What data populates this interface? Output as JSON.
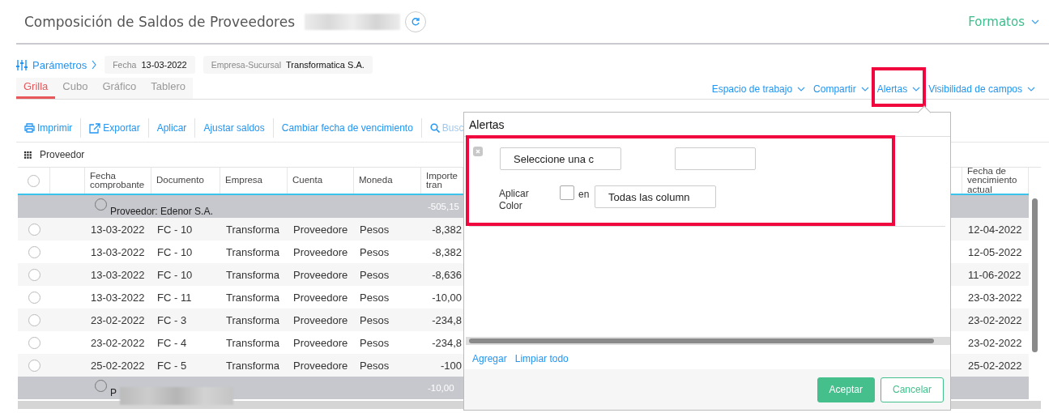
{
  "header": {
    "title": "Composición de Saldos de Proveedores",
    "formats_menu": "Formatos"
  },
  "parameters": {
    "label": "Parámetros",
    "fields": [
      {
        "label": "Fecha",
        "value": "13-03-2022"
      },
      {
        "label": "Empresa-Sucursal",
        "value": "Transformatica S.A."
      }
    ]
  },
  "tabs": [
    {
      "label": "Grilla",
      "selected": true
    },
    {
      "label": "Cubo",
      "selected": false
    },
    {
      "label": "Gráfico",
      "selected": false
    },
    {
      "label": "Tablero",
      "selected": false
    }
  ],
  "view_menus": [
    {
      "label": "Espacio de trabajo",
      "highlighted": false
    },
    {
      "label": "Compartir",
      "highlighted": false
    },
    {
      "label": "Alertas",
      "highlighted": true
    },
    {
      "label": "Visibilidad de campos",
      "highlighted": false
    }
  ],
  "toolbar": [
    {
      "kind": "print",
      "label": "Imprimir"
    },
    {
      "kind": "export",
      "label": "Exportar"
    },
    {
      "kind": "plain",
      "label": "Aplicar"
    },
    {
      "kind": "plain",
      "label": "Ajustar saldos"
    },
    {
      "kind": "plain",
      "label": "Cambiar fecha de vencimiento"
    },
    {
      "kind": "search",
      "label": "Busc"
    }
  ],
  "grouping": {
    "label": "Proveedor"
  },
  "table": {
    "all_selected": false,
    "columns": [
      "Fecha comprobante",
      "Documento",
      "Empresa",
      "Cuenta",
      "Moneda",
      "Importe tran",
      "Fecha de vencimiento actual"
    ],
    "rows": [
      {
        "kind": "group",
        "selected": false,
        "label": "Proveedor: Edenor S.A.",
        "amount": "-505,15"
      },
      {
        "kind": "data",
        "selected": false,
        "cells": [
          "13-03-2022",
          "FC - 10",
          "Transforma",
          "Proveedore",
          "Pesos",
          "-8,382",
          "12-04-2022"
        ]
      },
      {
        "kind": "data",
        "selected": false,
        "cells": [
          "13-03-2022",
          "FC - 10",
          "Transforma",
          "Proveedore",
          "Pesos",
          "-8,382",
          "12-05-2022"
        ]
      },
      {
        "kind": "data",
        "selected": false,
        "cells": [
          "13-03-2022",
          "FC - 10",
          "Transforma",
          "Proveedore",
          "Pesos",
          "-8,636",
          "11-06-2022"
        ]
      },
      {
        "kind": "data",
        "selected": false,
        "cells": [
          "13-03-2022",
          "FC - 11",
          "Transforma",
          "Proveedore",
          "Pesos",
          "-10,00",
          "23-03-2022"
        ]
      },
      {
        "kind": "data",
        "selected": false,
        "cells": [
          "23-02-2022",
          "FC - 3",
          "Transforma",
          "Proveedore",
          "Pesos",
          "-234,8",
          "23-02-2022"
        ]
      },
      {
        "kind": "data",
        "selected": false,
        "cells": [
          "23-02-2022",
          "FC - 4",
          "Transforma",
          "Proveedore",
          "Pesos",
          "-234,8",
          "23-02-2022"
        ]
      },
      {
        "kind": "data",
        "selected": false,
        "cells": [
          "25-02-2022",
          "FC - 5",
          "Transforma",
          "Proveedore",
          "Pesos",
          "-100",
          "25-02-2022"
        ]
      },
      {
        "kind": "group",
        "selected": false,
        "label": "P",
        "amount": "-10,00"
      }
    ]
  },
  "alerts_popup": {
    "title": "Alertas",
    "highlighted": true,
    "rule": {
      "column_select": "Seleccione una c",
      "apply_color_label": "Aplicar Color",
      "apply_color": false,
      "scope_label": "en",
      "scope_select": "Todas las column"
    },
    "links": [
      "Agregar",
      "Limpiar todo"
    ],
    "buttons": [
      {
        "kind": "primary",
        "label": "Aceptar"
      },
      {
        "kind": "secondary",
        "label": "Cancelar"
      }
    ]
  }
}
